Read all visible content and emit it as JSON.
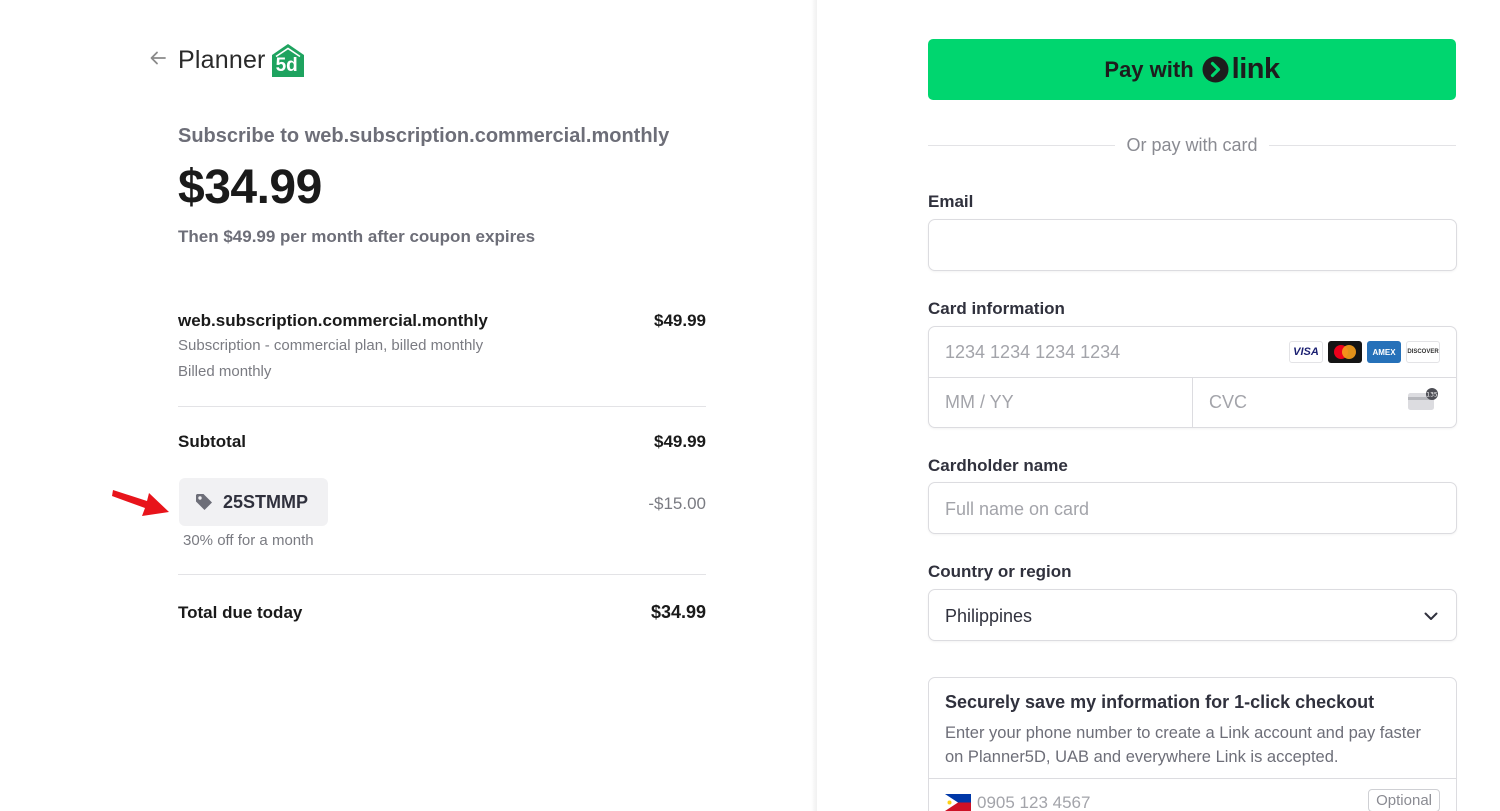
{
  "header": {
    "back_icon": "arrow-left-icon",
    "logo_text": "Planner",
    "logo_badge_text": "5d"
  },
  "summary": {
    "subscribe_title": "Subscribe to web.subscription.commercial.monthly",
    "price": "$34.99",
    "then_text": "Then $49.99 per month after coupon expires",
    "line_item": {
      "name": "web.subscription.commercial.monthly",
      "price": "$49.99",
      "description": "Subscription - commercial plan, billed monthly",
      "billing": "Billed monthly"
    },
    "subtotal_label": "Subtotal",
    "subtotal_value": "$49.99",
    "coupon": {
      "code": "25STMMP",
      "discount": "-$15.00",
      "description": "30% off for a month",
      "icon": "tag-icon"
    },
    "total_label": "Total due today",
    "total_value": "$34.99"
  },
  "payment": {
    "link_button": {
      "pay_with": "Pay with",
      "link_word": "link"
    },
    "or_text": "Or pay with card",
    "email": {
      "label": "Email",
      "value": ""
    },
    "card": {
      "label": "Card information",
      "number_placeholder": "1234 1234 1234 1234",
      "expiry_placeholder": "MM / YY",
      "cvc_placeholder": "CVC",
      "brands": [
        "VISA",
        "mastercard",
        "AMEX",
        "DISCOVER"
      ]
    },
    "cardholder": {
      "label": "Cardholder name",
      "placeholder": "Full name on card"
    },
    "country": {
      "label": "Country or region",
      "value": "Philippines"
    },
    "save_info": {
      "title": "Securely save my information for 1-click checkout",
      "description": "Enter your phone number to create a Link account and pay faster on Planner5D, UAB and everywhere Link is accepted.",
      "phone_placeholder": "0905 123 4567",
      "optional_label": "Optional"
    }
  },
  "colors": {
    "link_green": "#00d66f",
    "logo_green": "#1ea35f",
    "annotation_red": "#e8141b"
  }
}
